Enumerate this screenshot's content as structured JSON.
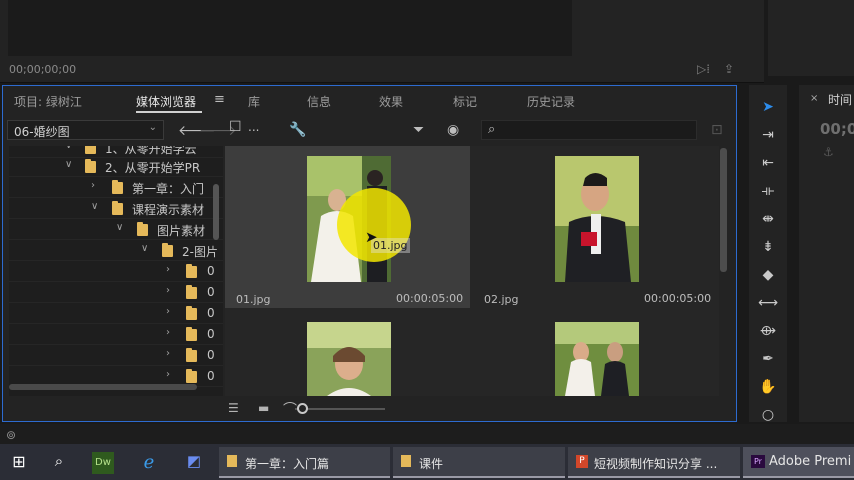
{
  "monitor": {
    "timecode": "00;00;00;00"
  },
  "panel": {
    "tabs": [
      {
        "label": "项目: 绿树江",
        "active": false
      },
      {
        "label": "媒体浏览器",
        "active": true
      },
      {
        "label": "库",
        "active": false
      },
      {
        "label": "信息",
        "active": false
      },
      {
        "label": "效果",
        "active": false
      },
      {
        "label": "标记",
        "active": false
      },
      {
        "label": "历史记录",
        "active": false
      }
    ],
    "tab_menu_icon": "≡",
    "folder_select": "06-婚纱图",
    "toolbar_dots": "...",
    "search_placeholder": ""
  },
  "tree": [
    {
      "label": "1、从零开始学云",
      "arrow": "∨",
      "depth": 3
    },
    {
      "label": "2、从零开始学PR",
      "arrow": "∨",
      "depth": 3
    },
    {
      "label": "第一章：入门",
      "arrow": "›",
      "depth": 4
    },
    {
      "label": "课程演示素材",
      "arrow": "∨",
      "depth": 4
    },
    {
      "label": "图片素材",
      "arrow": "∨",
      "depth": 5
    },
    {
      "label": "2-图片",
      "arrow": "∨",
      "depth": 6
    },
    {
      "label": "0",
      "arrow": "›",
      "depth": 7
    },
    {
      "label": "0",
      "arrow": "›",
      "depth": 7
    },
    {
      "label": "0",
      "arrow": "›",
      "depth": 7
    },
    {
      "label": "0",
      "arrow": "›",
      "depth": 7
    },
    {
      "label": "0",
      "arrow": "›",
      "depth": 7
    },
    {
      "label": "0",
      "arrow": "›",
      "depth": 7
    }
  ],
  "thumbnails": [
    {
      "name": "01.jpg",
      "duration": "00:00:05:00",
      "selected": true,
      "drag_label": "01.jpg"
    },
    {
      "name": "02.jpg",
      "duration": "00:00:05:00",
      "selected": false
    },
    {
      "name": "",
      "duration": "",
      "selected": false
    },
    {
      "name": "",
      "duration": "",
      "selected": false
    }
  ],
  "timeline": {
    "title": "时间",
    "timecode": "00;0"
  },
  "taskbar": {
    "buttons": [
      {
        "label": "第一章：入门篇",
        "icon": "folder-icon"
      },
      {
        "label": "课件",
        "icon": "folder-icon"
      },
      {
        "label": "短视频制作知识分享 ...",
        "icon": "powerpoint-icon"
      },
      {
        "label": "Adobe Premi",
        "icon": "premiere-icon",
        "active": true
      }
    ]
  },
  "colors": {
    "accent_blue": "#2d6bd0",
    "folder": "#e5b95a",
    "cursor_highlight": "#f2e600"
  }
}
